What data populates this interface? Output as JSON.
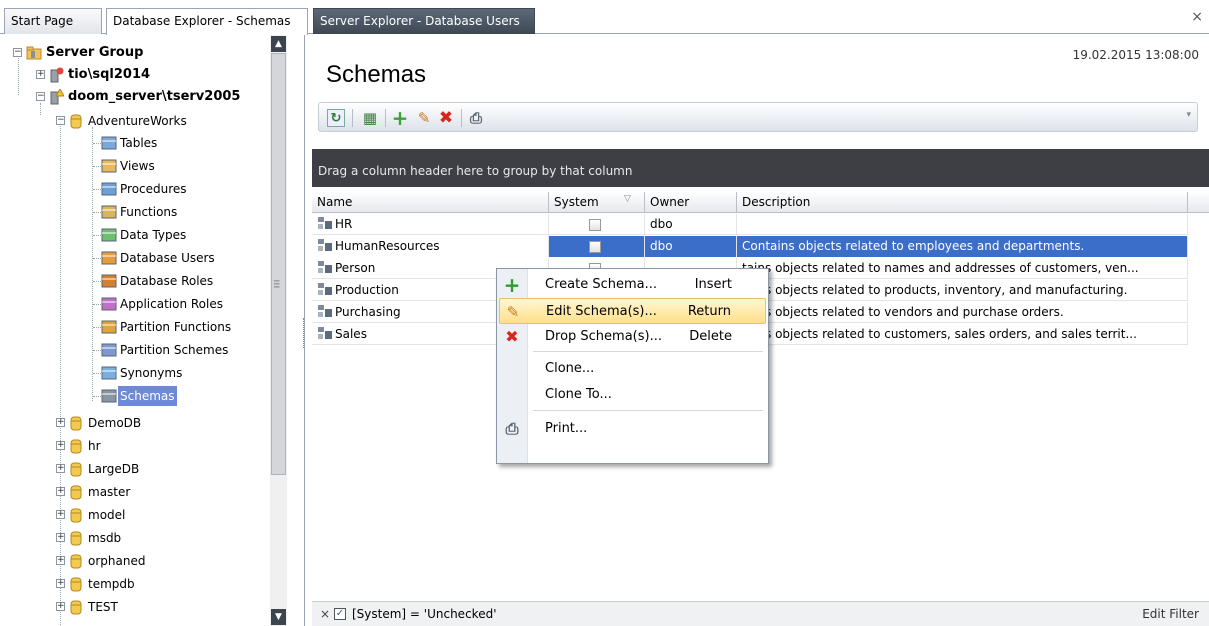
{
  "tabs": [
    {
      "label": "Start Page"
    },
    {
      "label": "Database Explorer - Schemas"
    },
    {
      "label": "Server Explorer - Database Users"
    }
  ],
  "close_glyph": "×",
  "tree": {
    "root": "Server Group",
    "servers": [
      "tio\\sql2014",
      "doom_server\\tserv2005"
    ],
    "db": "AdventureWorks",
    "children": [
      "Tables",
      "Views",
      "Procedures",
      "Functions",
      "Data Types",
      "Database Users",
      "Database Roles",
      "Application Roles",
      "Partition Functions",
      "Partition Schemes",
      "Synonyms",
      "Schemas"
    ],
    "databases": [
      "DemoDB",
      "hr",
      "LargeDB",
      "master",
      "model",
      "msdb",
      "orphaned",
      "tempdb",
      "TEST"
    ]
  },
  "page": {
    "title": "Schemas",
    "timestamp": "19.02.2015 13:08:00"
  },
  "grid": {
    "group_panel": "Drag a column header here to group by that column",
    "columns": [
      "Name",
      "System",
      "Owner",
      "Description"
    ],
    "rows": [
      {
        "name": "HR",
        "owner": "dbo",
        "desc": ""
      },
      {
        "name": "HumanResources",
        "owner": "dbo",
        "desc": "Contains objects related to employees and departments."
      },
      {
        "name": "Person",
        "owner": "",
        "desc": "tains objects related to names and addresses of customers, ven..."
      },
      {
        "name": "Production",
        "owner": "",
        "desc": "tains objects related to products, inventory, and manufacturing."
      },
      {
        "name": "Purchasing",
        "owner": "",
        "desc": "tains objects related to vendors and purchase orders."
      },
      {
        "name": "Sales",
        "owner": "",
        "desc": "tains objects related to customers, sales orders, and sales territ..."
      }
    ]
  },
  "context_menu": [
    {
      "label": "Create Schema...",
      "shortcut": "Insert",
      "icon": "plus-icon"
    },
    {
      "label": "Edit Schema(s)...",
      "shortcut": "Return",
      "icon": "pencil-icon"
    },
    {
      "label": "Drop Schema(s)...",
      "shortcut": "Delete",
      "icon": "delete-x-icon"
    },
    {
      "label": "Clone...",
      "shortcut": "",
      "icon": ""
    },
    {
      "label": "Clone To...",
      "shortcut": "",
      "icon": ""
    },
    {
      "label": "Print...",
      "shortcut": "",
      "icon": "printer-icon"
    }
  ],
  "filter": {
    "text": "[System] = 'Unchecked'",
    "edit_label": "Edit Filter"
  },
  "colors": {
    "accent": "#3b6ec9",
    "tree_selection": "#6e8ad6",
    "group_panel": "#3d3f44",
    "menu_hot": "#ffe08a"
  }
}
